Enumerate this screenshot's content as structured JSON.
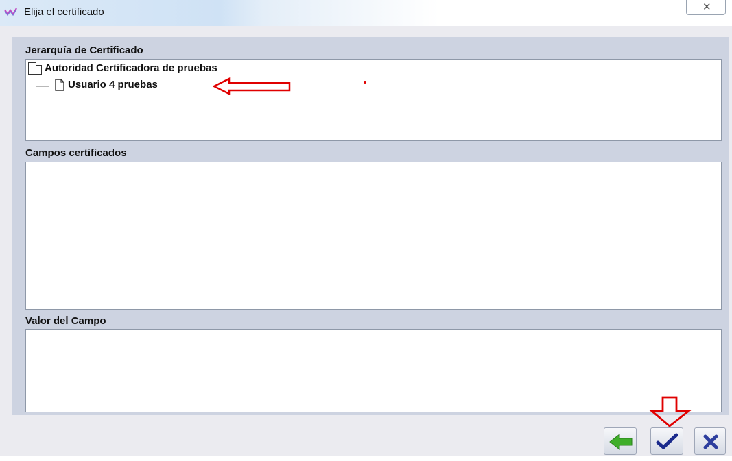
{
  "window": {
    "title": "Elija el certificado",
    "icon": "app-logo-icon",
    "close_glyph": "✕"
  },
  "sections": {
    "hierarchy": {
      "label": "Jerarquía de Certificado",
      "tree": {
        "root": {
          "label": "Autoridad Certificadora de pruebas",
          "icon": "folder-icon"
        },
        "child": {
          "label": "Usuario 4 pruebas",
          "icon": "document-icon",
          "selected": true
        }
      }
    },
    "fields": {
      "label": "Campos certificados"
    },
    "value": {
      "label": "Valor del Campo"
    }
  },
  "buttons": {
    "back": {
      "icon": "green-left-arrow-icon"
    },
    "accept": {
      "icon": "blue-checkmark-icon"
    },
    "cancel": {
      "icon": "blue-x-icon"
    }
  },
  "annotations": {
    "arrow_color": "#e00000"
  }
}
